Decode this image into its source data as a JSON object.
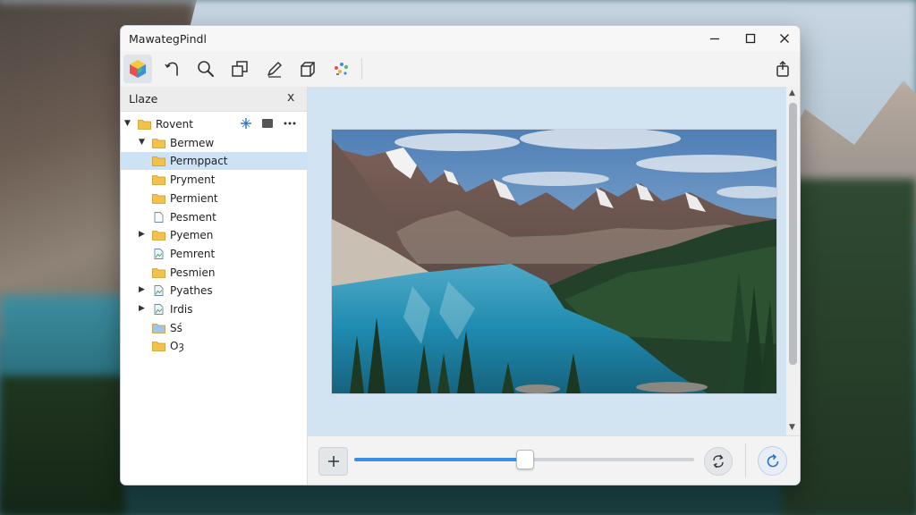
{
  "window": {
    "title": "MawategPindl"
  },
  "toolbar": {
    "tools": [
      {
        "icon": "color-cube-icon",
        "active": true
      },
      {
        "icon": "hook-arrow-icon"
      },
      {
        "icon": "zoom-icon"
      },
      {
        "icon": "crop-icon"
      },
      {
        "icon": "pen-icon"
      },
      {
        "icon": "box-icon"
      },
      {
        "icon": "sparkle-dots-icon"
      }
    ],
    "right_tool": "share-icon"
  },
  "sidebar": {
    "title": "Llaze",
    "close_glyph": "x",
    "tree": [
      {
        "label": "Rovent",
        "type": "folder",
        "twisty": "open",
        "level": 0
      },
      {
        "label": "Bermew",
        "type": "folder",
        "twisty": "open",
        "level": 1
      },
      {
        "label": "Permppact",
        "type": "folder",
        "level": 1,
        "selected": true
      },
      {
        "label": "Pryment",
        "type": "folder",
        "level": 1
      },
      {
        "label": "Permient",
        "type": "folder",
        "level": 1
      },
      {
        "label": "Pesment",
        "type": "file",
        "level": 1
      },
      {
        "label": "Pyemen",
        "type": "folder",
        "twisty": "closed",
        "level": 1
      },
      {
        "label": "Pemrent",
        "type": "image-file",
        "level": 1
      },
      {
        "label": "Pesmien",
        "type": "folder",
        "level": 1
      },
      {
        "label": "Pyathes",
        "type": "image-file",
        "twisty": "closed",
        "level": 1
      },
      {
        "label": "Irdis",
        "type": "image-file",
        "twisty": "closed",
        "level": 1
      },
      {
        "label": "Sś",
        "type": "folder-blue",
        "level": 1
      },
      {
        "label": "Oȝ",
        "type": "folder",
        "level": 1
      }
    ]
  },
  "viewer": {
    "zoom_percent": 50
  },
  "colors": {
    "accent": "#3b8ee6",
    "canvas_bg": "#d2e3f2",
    "folder": "#f2c14e",
    "selection": "#cde3f5"
  }
}
